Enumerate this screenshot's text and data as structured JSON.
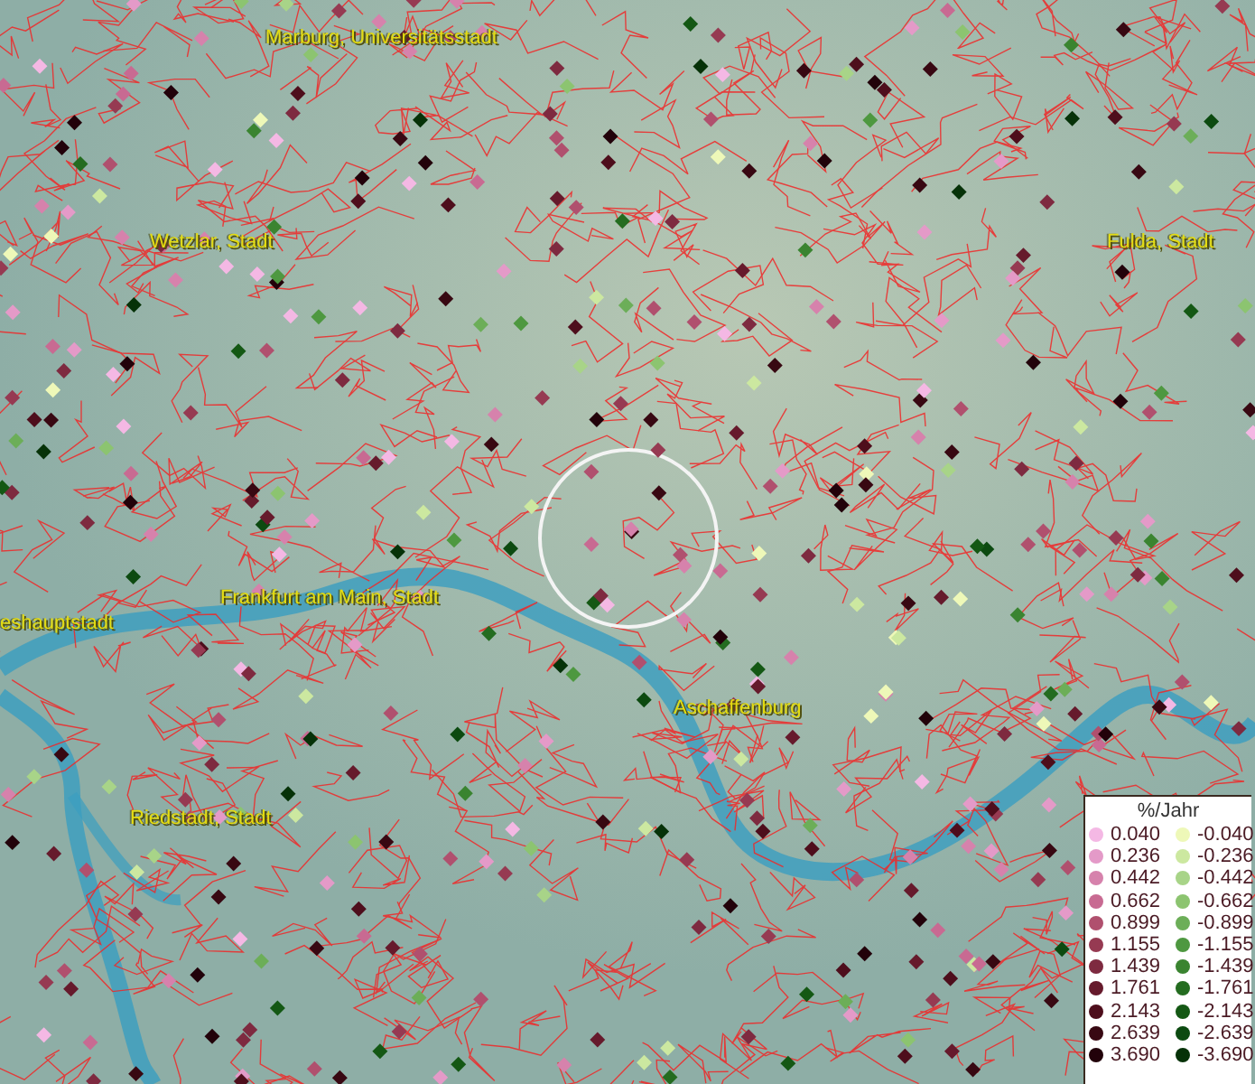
{
  "map": {
    "places": [
      {
        "name": "Marburg, Universitätsstadt"
      },
      {
        "name": "Wetzlar, Stadt"
      },
      {
        "name": "Fulda, Stadt"
      },
      {
        "name": "Frankfurt am Main, Stadt"
      },
      {
        "name": "eshauptstadt"
      },
      {
        "name": "Aschaffenburg"
      },
      {
        "name": "Riedstadt, Stadt"
      }
    ]
  },
  "legend": {
    "title": "%/Jahr",
    "positive": [
      {
        "value": "0.040",
        "color": "#f4b8e4"
      },
      {
        "value": "0.236",
        "color": "#e49ac8"
      },
      {
        "value": "0.442",
        "color": "#d682ac"
      },
      {
        "value": "0.662",
        "color": "#c86a92"
      },
      {
        "value": "0.899",
        "color": "#b0506e"
      },
      {
        "value": "1.155",
        "color": "#963a52"
      },
      {
        "value": "1.439",
        "color": "#7e2a40"
      },
      {
        "value": "1.761",
        "color": "#661a2c"
      },
      {
        "value": "2.143",
        "color": "#4e0e1c"
      },
      {
        "value": "2.639",
        "color": "#380812"
      },
      {
        "value": "3.690",
        "color": "#22020a"
      }
    ],
    "negative": [
      {
        "value": "-0.040",
        "color": "#eef8b8"
      },
      {
        "value": "-0.236",
        "color": "#cce8a0"
      },
      {
        "value": "-0.442",
        "color": "#a8d488"
      },
      {
        "value": "-0.662",
        "color": "#8cc470"
      },
      {
        "value": "-0.899",
        "color": "#6cae58"
      },
      {
        "value": "-1.155",
        "color": "#4e9840"
      },
      {
        "value": "-1.439",
        "color": "#3a8430"
      },
      {
        "value": "-1.761",
        "color": "#246c20"
      },
      {
        "value": "-2.143",
        "color": "#145814"
      },
      {
        "value": "-2.639",
        "color": "#0c4a10"
      },
      {
        "value": "-3.690",
        "color": "#063208"
      }
    ]
  }
}
